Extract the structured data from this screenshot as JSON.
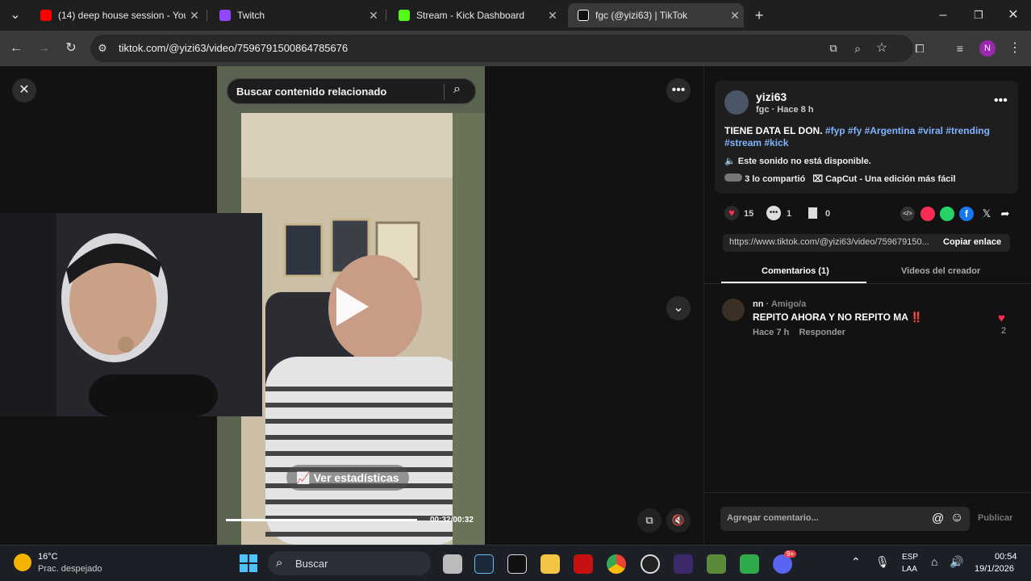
{
  "browser": {
    "tabs": [
      {
        "title": "(14) deep house session - YouTube",
        "color": "#ff0000"
      },
      {
        "title": "Twitch",
        "color": "#9146ff"
      },
      {
        "title": "Stream - Kick Dashboard",
        "color": "#53fc18"
      },
      {
        "title": "fgc (@yizi63) | TikTok",
        "color": "#ffffff"
      }
    ],
    "url": "tiktok.com/@yizi63/video/7596791500864785676",
    "profile_initial": "N"
  },
  "video": {
    "search_placeholder": "Buscar contenido relacionado",
    "stats_label": "Ver estadísticas",
    "time": "00:32/00:32",
    "progress": 1.0
  },
  "post": {
    "username": "yizi63",
    "subline": "fgc · Hace 8 h",
    "caption": "TIENE DATA EL DON.",
    "hashtags": "#fyp #fy #Argentina #viral #trending #stream #kick",
    "sound": "Este sonido no está disponible.",
    "shared": "3 lo compartió",
    "capcut": "CapCut - Una edición más fácil",
    "likes": "15",
    "comments": "1",
    "saves": "0",
    "link": "https://www.tiktok.com/@yizi63/video/759679150...",
    "copy_label": "Copiar enlace",
    "tab_comments": "Comentarios (1)",
    "tab_creator": "Videos del creador"
  },
  "comment": {
    "author": "nn",
    "relation": "· Amigo/a",
    "text": "REPITO AHORA Y NO REPITO MA ‼️",
    "time": "Hace 7 h",
    "reply": "Responder",
    "like_count": "2"
  },
  "composer": {
    "placeholder": "Agregar comentario...",
    "publish": "Publicar"
  },
  "taskbar": {
    "temp": "16°C",
    "weather": "Prac. despejado",
    "search": "Buscar",
    "lang1": "ESP",
    "lang2": "LAA",
    "time": "00:54",
    "date": "19/1/2026",
    "discord_badge": "9+"
  }
}
